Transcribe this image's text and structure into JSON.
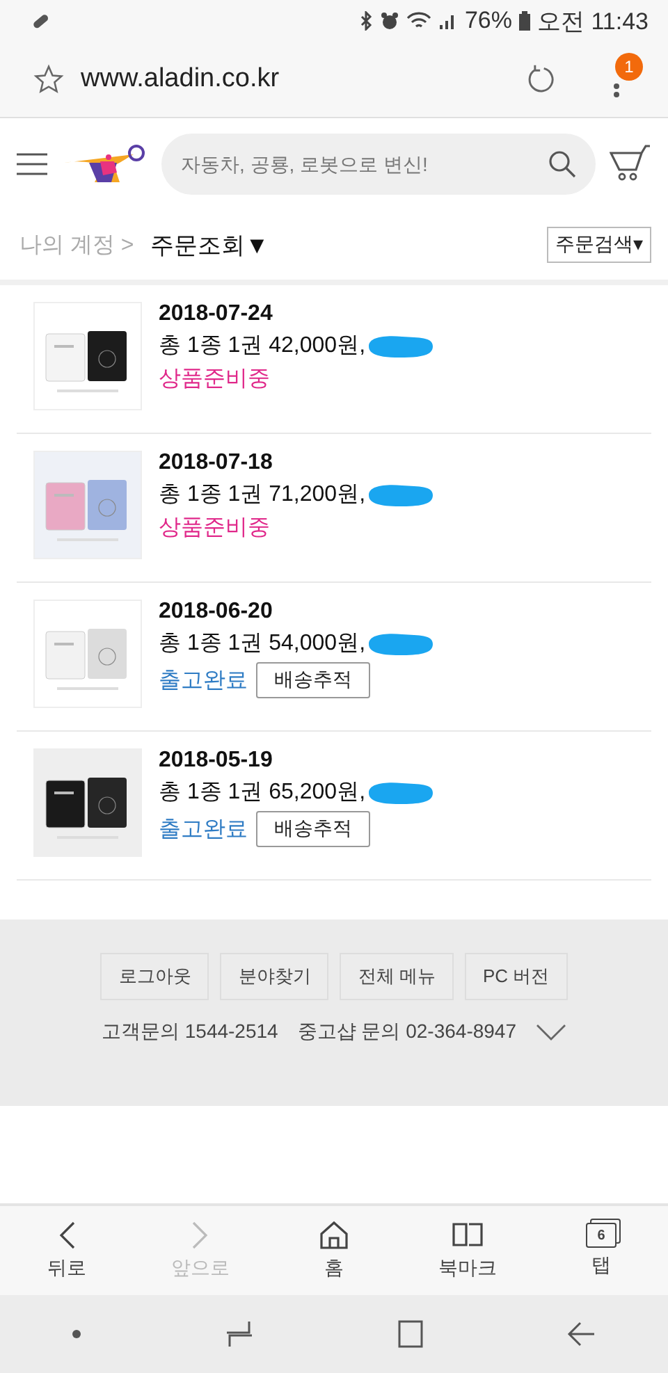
{
  "status_bar": {
    "battery": "76%",
    "time": "오전 11:43"
  },
  "browser": {
    "url": "www.aladin.co.kr",
    "menu_badge": "1"
  },
  "header": {
    "search": {
      "placeholder": "자동차, 공룡, 로봇으로 변신!"
    }
  },
  "breadcrumb": {
    "parent": "나의 계정 >",
    "current": "주문조회",
    "current_caret": "▼",
    "search_button": "주문검색▾"
  },
  "orders": [
    {
      "date": "2018-07-24",
      "summary": "총 1종 1권 42,000원,",
      "redacted": true,
      "status": {
        "text": "상품준비중",
        "color": "#e0288a"
      }
    },
    {
      "date": "2018-07-18",
      "summary": "총 1종 1권 71,200원,",
      "redacted": true,
      "status": {
        "text": "상품준비중",
        "color": "#e0288a"
      }
    },
    {
      "date": "2018-06-20",
      "summary": "총 1종 1권 54,000원,",
      "redacted": true,
      "status": {
        "text": "출고완료",
        "color": "#2f7cc4"
      },
      "track_button": "배송추적"
    },
    {
      "date": "2018-05-19",
      "summary": "총 1종 1권 65,200원,",
      "redacted": true,
      "status": {
        "text": "출고완료",
        "color": "#2f7cc4"
      },
      "track_button": "배송추적"
    }
  ],
  "footer": {
    "buttons": [
      "로그아웃",
      "분야찾기",
      "전체 메뉴",
      "PC 버전"
    ],
    "contacts": [
      "고객문의 1544-2514",
      "중고샵 문의 02-364-8947"
    ]
  },
  "toolbar": [
    {
      "kind": "back",
      "label": "뒤로",
      "disabled": false
    },
    {
      "kind": "forward",
      "label": "앞으로",
      "disabled": true
    },
    {
      "kind": "home",
      "label": "홈",
      "disabled": false
    },
    {
      "kind": "bookmark",
      "label": "북마크",
      "disabled": false
    },
    {
      "kind": "tabs",
      "label": "탭",
      "count": "6",
      "disabled": false
    }
  ]
}
